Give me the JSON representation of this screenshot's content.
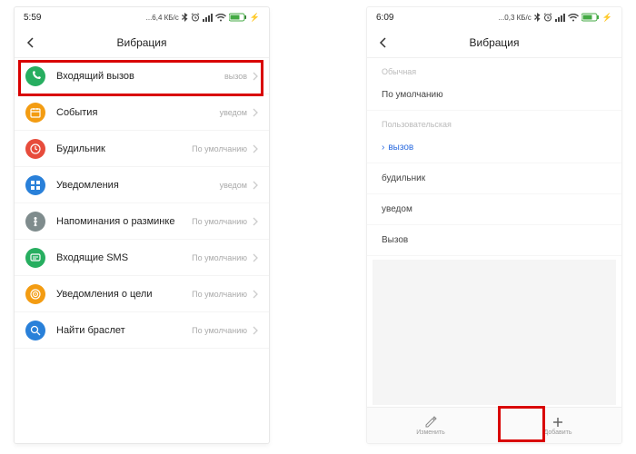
{
  "left": {
    "status": {
      "time": "5:59",
      "kbps": "...6,4 КБ/с"
    },
    "header_title": "Вибрация",
    "rows": [
      {
        "name": "incoming-call",
        "label": "Входящий вызов",
        "value": "вызов",
        "bg": "#27ae60",
        "icon": "phone"
      },
      {
        "name": "events",
        "label": "События",
        "value": "уведом",
        "bg": "#f39c12",
        "icon": "calendar"
      },
      {
        "name": "alarm",
        "label": "Будильник",
        "value": "По умолчанию",
        "bg": "#e74c3c",
        "icon": "clock"
      },
      {
        "name": "notifications",
        "label": "Уведомления",
        "value": "уведом",
        "bg": "#2980d9",
        "icon": "app"
      },
      {
        "name": "stretch-reminder",
        "label": "Напоминания о разминке",
        "value": "По умолчанию",
        "bg": "#7f8c8d",
        "icon": "stand"
      },
      {
        "name": "sms",
        "label": "Входящие SMS",
        "value": "По умолчанию",
        "bg": "#27ae60",
        "icon": "sms"
      },
      {
        "name": "goal",
        "label": "Уведомления о цели",
        "value": "По умолчанию",
        "bg": "#f39c12",
        "icon": "goal"
      },
      {
        "name": "find-band",
        "label": "Найти браслет",
        "value": "По умолчанию",
        "bg": "#2980d9",
        "icon": "search"
      }
    ]
  },
  "right": {
    "status": {
      "time": "6:09",
      "kbps": "...0,3 КБ/с"
    },
    "header_title": "Вибрация",
    "section_default": "Обычная",
    "option_default": "По умолчанию",
    "section_custom": "Пользовательская",
    "options_custom": [
      {
        "label": "вызов",
        "selected": true
      },
      {
        "label": "будильник",
        "selected": false
      },
      {
        "label": "уведом",
        "selected": false
      },
      {
        "label": "Вызов",
        "selected": false
      }
    ],
    "bottom": {
      "edit": "Изменить",
      "add": "Добавить"
    }
  }
}
